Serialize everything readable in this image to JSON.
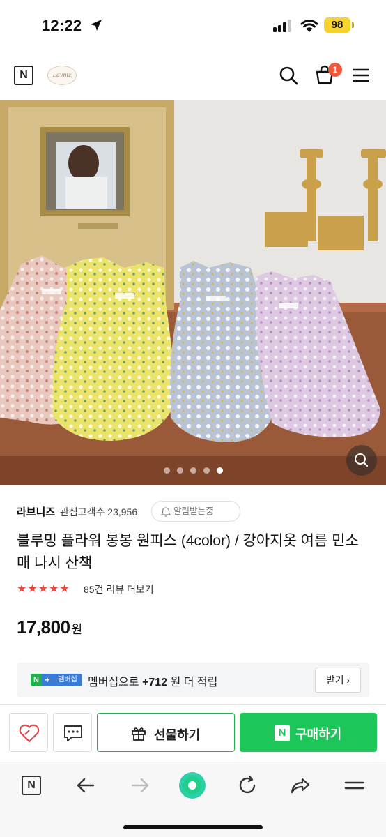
{
  "status_bar": {
    "time": "12:22",
    "battery": "98"
  },
  "header": {
    "logo": "N",
    "brand_badge": "Lavniz",
    "cart_count": "1",
    "icons": [
      "search-icon",
      "cart-icon",
      "menu-icon"
    ]
  },
  "gallery": {
    "total_images": 5,
    "current_index": 5
  },
  "seller": {
    "name": "라브니즈",
    "followers": "관심고객수 23,956",
    "notify_label": "알림받는중"
  },
  "product": {
    "title": "블루밍 플라워 봉봉 원피스 (4color) / 강아지옷 여름 민소매 나시 산책",
    "rating_stars": "★★★★★",
    "review_link": "85건 리뷰 더보기",
    "price": "17,800",
    "currency": "원"
  },
  "membership": {
    "badge_n": "N",
    "badge_plus": "+",
    "badge_text": "멤버십",
    "prefix": "멤버십으로",
    "points": "+712",
    "suffix": "원 더 적립",
    "receive_button": "받기 ›"
  },
  "actions": {
    "gift_label": "선물하기",
    "buy_icon": "N",
    "buy_label": "구매하기"
  },
  "colors": {
    "naver_green": "#1ec659",
    "star_red": "#e8483b",
    "cart_badge": "#f05a3a",
    "battery_yellow": "#f7d330"
  }
}
